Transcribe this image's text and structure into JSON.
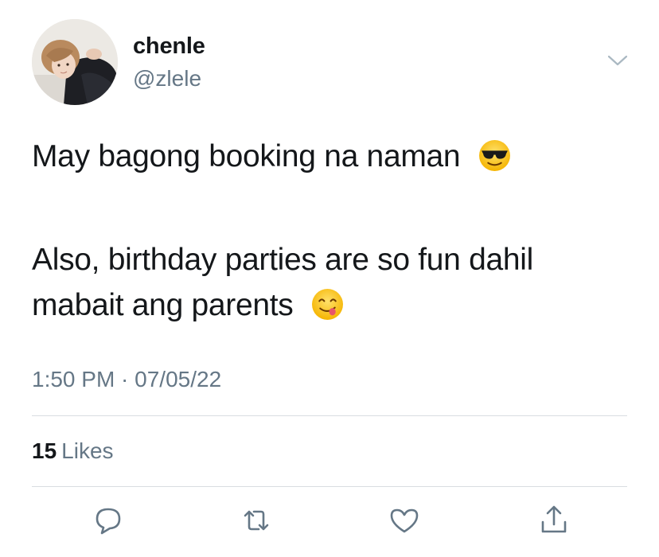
{
  "user": {
    "display_name": "chenle",
    "handle": "@zlele",
    "avatar_icon": "profile-photo-avatar"
  },
  "tweet": {
    "line1": "May bagong booking na naman",
    "line1_emoji": "smiling-face-with-sunglasses-emoji",
    "line2": "Also, birthday parties are so fun dahil",
    "line3": "mabait ang parents",
    "line3_emoji": "face-savoring-food-emoji"
  },
  "timestamp": "1:50 PM · 07/05/22",
  "likes": {
    "count": "15",
    "label": "Likes"
  },
  "actions": [
    {
      "icon": "reply-icon"
    },
    {
      "icon": "retweet-icon"
    },
    {
      "icon": "like-heart-icon"
    },
    {
      "icon": "share-icon"
    }
  ],
  "colors": {
    "primary_text": "#14171a",
    "secondary_text": "#657786",
    "divider": "#d9dde1",
    "icon": "#657786"
  }
}
